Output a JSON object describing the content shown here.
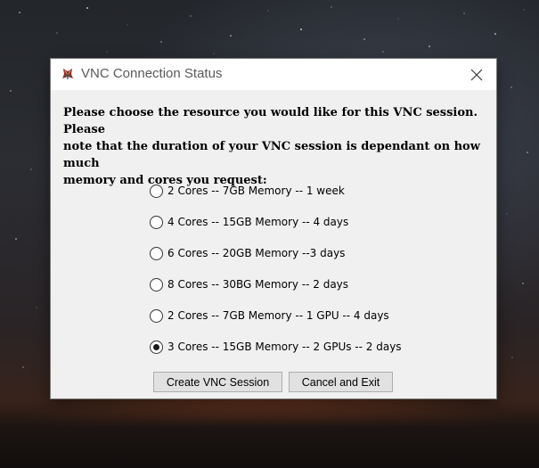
{
  "window": {
    "title": "VNC Connection Status"
  },
  "prompt": {
    "line1": "Please choose the resource you would like for this VNC session. Please",
    "line2": "note that the duration of your VNC session is dependant on how much",
    "line3": "memory and cores you request:"
  },
  "options": [
    {
      "label": "2 Cores -- 7GB Memory -- 1 week",
      "selected": false
    },
    {
      "label": "4 Cores -- 15GB Memory -- 4 days",
      "selected": false
    },
    {
      "label": "6 Cores -- 20GB Memory --3 days",
      "selected": false
    },
    {
      "label": "8 Cores -- 30BG Memory -- 2 days",
      "selected": false
    },
    {
      "label": "2 Cores -- 7GB Memory -- 1 GPU -- 4 days",
      "selected": false
    },
    {
      "label": "3 Cores -- 15GB Memory -- 2 GPUs -- 2 days",
      "selected": true
    }
  ],
  "buttons": {
    "create_label": "Create VNC Session",
    "cancel_label": "Cancel and Exit"
  },
  "icons": {
    "app": "tk-feather-icon",
    "close": "close-icon",
    "radio_selected": "radio-selected",
    "radio_unselected": "radio-unselected"
  },
  "colors": {
    "dialog_bg": "#f0f0f0",
    "titlebar_bg": "#ffffff",
    "button_bg": "#e1e1e1",
    "button_border": "#adadad"
  }
}
